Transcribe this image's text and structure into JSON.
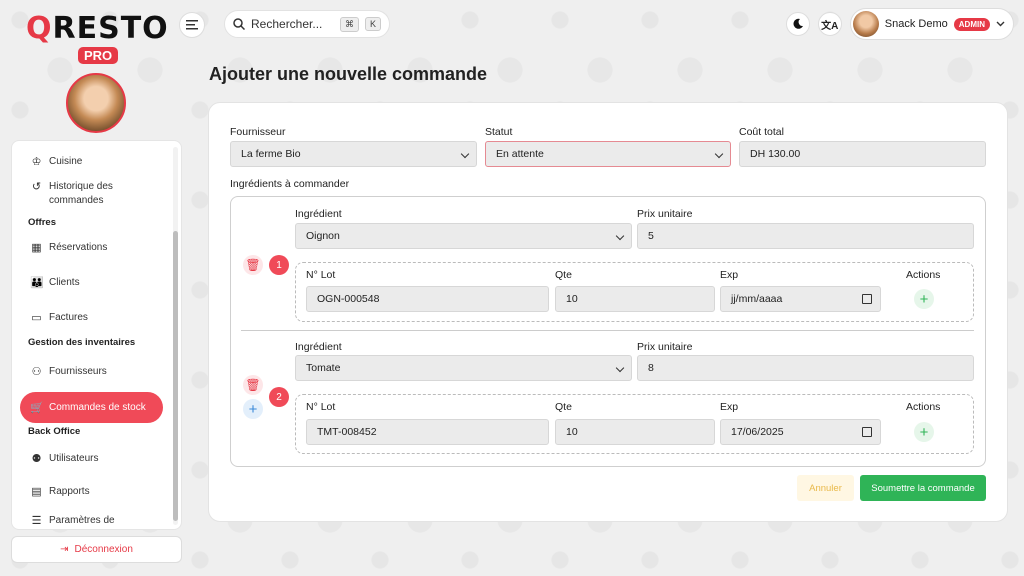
{
  "brand": {
    "logo_q": "Q",
    "logo_rest": "RESTO",
    "pro": "PRO"
  },
  "search": {
    "placeholder": "Rechercher...",
    "kbd_cmd": "⌘",
    "kbd_key": "K"
  },
  "user": {
    "name": "Snack Demo",
    "role": "ADMIN"
  },
  "sidebar": {
    "items": [
      {
        "label": "Cuisine",
        "icon": "chef-hat-icon"
      },
      {
        "label": "Historique des commandes",
        "icon": "history-icon"
      },
      {
        "section": "Offres"
      },
      {
        "label": "Réservations",
        "icon": "calendar-icon"
      },
      {
        "label": "Clients",
        "icon": "users-icon"
      },
      {
        "label": "Factures",
        "icon": "file-icon"
      },
      {
        "section": "Gestion des inventaires"
      },
      {
        "label": "Fournisseurs",
        "icon": "supplier-icon"
      },
      {
        "label": "Commandes de stock",
        "icon": "cart-icon",
        "active": true
      },
      {
        "section": "Back Office"
      },
      {
        "label": "Utilisateurs",
        "icon": "user-icon"
      },
      {
        "label": "Rapports",
        "icon": "report-icon"
      },
      {
        "label": "Paramètres de l'entreprise",
        "icon": "settings-icon"
      }
    ],
    "logout": "Déconnexion"
  },
  "page": {
    "title": "Ajouter une nouvelle commande",
    "fournisseur_label": "Fournisseur",
    "fournisseur_value": "La ferme Bio",
    "statut_label": "Statut",
    "statut_value": "En attente",
    "cout_label": "Coût total",
    "cout_value": "DH 130.00",
    "ingredients_label": "Ingrédients à commander",
    "ingredient_label": "Ingrédient",
    "prix_label": "Prix unitaire",
    "lot_label": "N° Lot",
    "qte_label": "Qte",
    "exp_label": "Exp",
    "actions_label": "Actions",
    "rows": [
      {
        "num": "1",
        "ingredient": "Oignon",
        "prix": "5",
        "lot": "OGN-000548",
        "qte": "10",
        "exp": "jj/mm/aaaa"
      },
      {
        "num": "2",
        "ingredient": "Tomate",
        "prix": "8",
        "lot": "TMT-008452",
        "qte": "10",
        "exp": "17/06/2025"
      }
    ],
    "cancel": "Annuler",
    "submit": "Soumettre la commande"
  },
  "colors": {
    "accent": "#e63946",
    "success": "#2fb457"
  }
}
